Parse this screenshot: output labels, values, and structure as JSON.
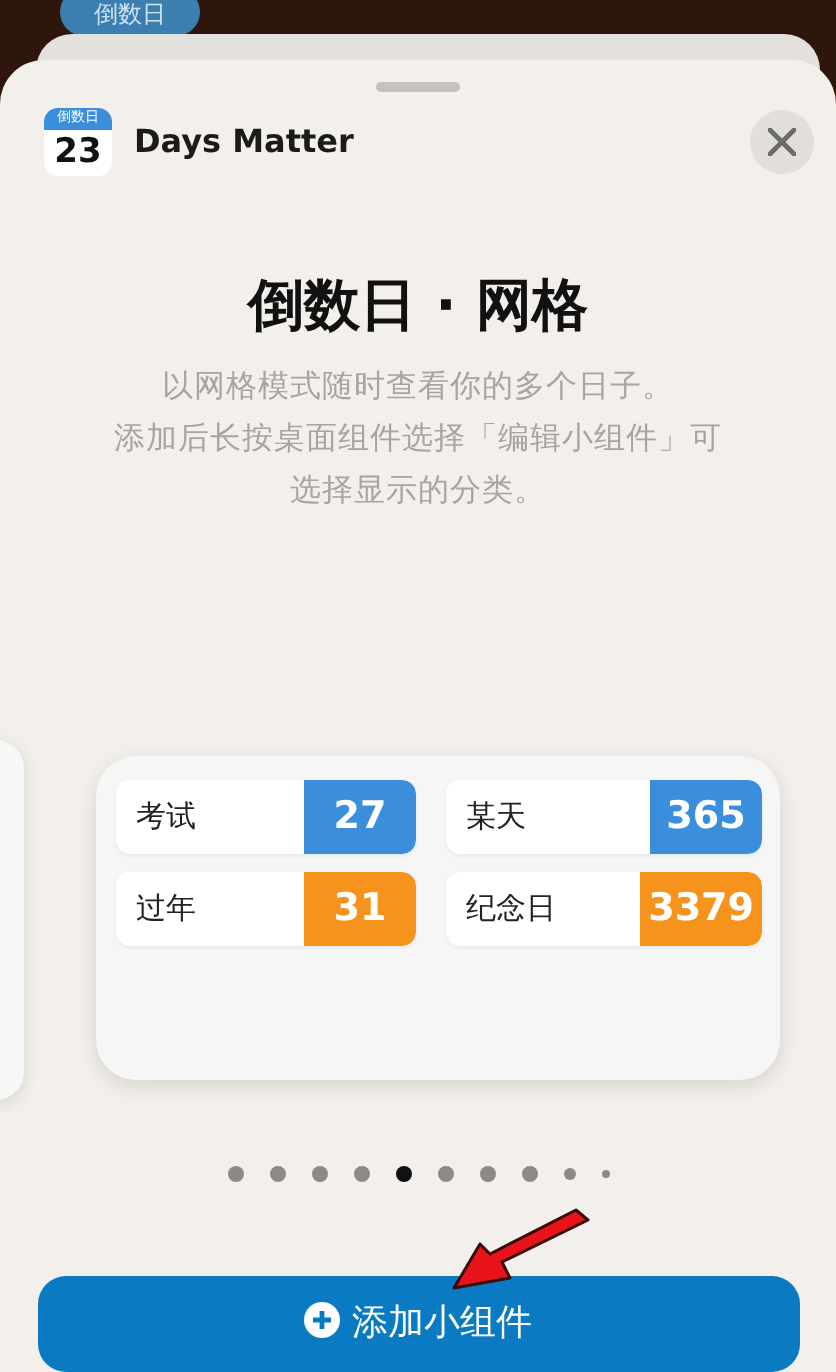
{
  "background_tab": {
    "label": "倒数日"
  },
  "header": {
    "icon_label": "倒数日",
    "icon_day": "23",
    "app_name": "Days Matter"
  },
  "widget": {
    "title": "倒数日 · 网格",
    "description_lines": [
      "以网格模式随时查看你的多个日子。",
      "添加后长按桌面组件选择「编辑小组件」可",
      "选择显示的分类。"
    ],
    "items": [
      {
        "label": "考试",
        "value": "27",
        "color": "#3a8edb"
      },
      {
        "label": "某天",
        "value": "365",
        "color": "#3a8edb"
      },
      {
        "label": "过年",
        "value": "31",
        "color": "#f5931c"
      },
      {
        "label": "纪念日",
        "value": "3379",
        "color": "#f5931c"
      }
    ]
  },
  "page_dots": [
    {
      "selected": false
    },
    {
      "selected": false
    },
    {
      "selected": false
    },
    {
      "selected": false
    },
    {
      "selected": true
    },
    {
      "selected": false
    },
    {
      "selected": false
    },
    {
      "selected": false
    },
    {
      "selected": false
    },
    {
      "selected": false
    }
  ],
  "add_button": {
    "label": "添加小组件"
  }
}
